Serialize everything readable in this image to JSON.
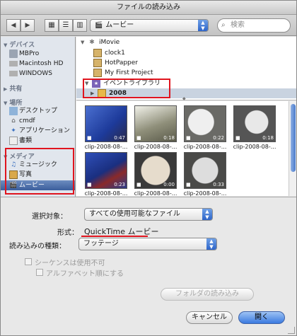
{
  "window": {
    "title": "ファイルの読み込み"
  },
  "toolbar": {
    "location": "ムービー",
    "search_placeholder": "検索"
  },
  "sidebar": {
    "devices_header": "デバイス",
    "devices": [
      "MBPro",
      "Macintosh HD",
      "WINDOWS"
    ],
    "shared_header": "共有",
    "places_header": "場所",
    "places": [
      "デスクトップ",
      "cmdf",
      "アプリケーション",
      "書類"
    ],
    "media_header": "メディア",
    "media": [
      "ミュージック",
      "写真",
      "ムービー"
    ],
    "selected": "ムービー"
  },
  "browser": {
    "root": "iMovie",
    "projects": [
      "clock1",
      "HotPapper",
      "My First Project"
    ],
    "event_library": "イベントライブラリ",
    "event_year": "2008"
  },
  "clips": [
    {
      "name": "clip-2008-08-...",
      "duration": "0:47"
    },
    {
      "name": "clip-2008-08-...",
      "duration": "0:18"
    },
    {
      "name": "clip-2008-08-...",
      "duration": "0:22"
    },
    {
      "name": "clip-2008-08-...",
      "duration": "0:18"
    },
    {
      "name": "clip-2008-08-...",
      "duration": "0:23"
    },
    {
      "name": "clip-2008-08-...",
      "duration": "0:00"
    },
    {
      "name": "clip-2008-08-...",
      "duration": "0:33"
    }
  ],
  "options": {
    "enable_label": "選択対象：",
    "enable_value": "すべての使用可能なファイル",
    "format_label": "形式：",
    "format_value": "QuickTime ムービー",
    "import_type_label": "読み込みの種類：",
    "import_type_value": "フッテージ",
    "sequence_label": "シーケンスは使用不可",
    "alpha_label": "アルファベット順にする",
    "folder_button": "フォルダの読み込み"
  },
  "buttons": {
    "cancel": "キャンセル",
    "open": "開く"
  },
  "colors": {
    "annotation": "#e0141e",
    "selection": "#3b5e9c",
    "primary": "#3a7ae0"
  }
}
